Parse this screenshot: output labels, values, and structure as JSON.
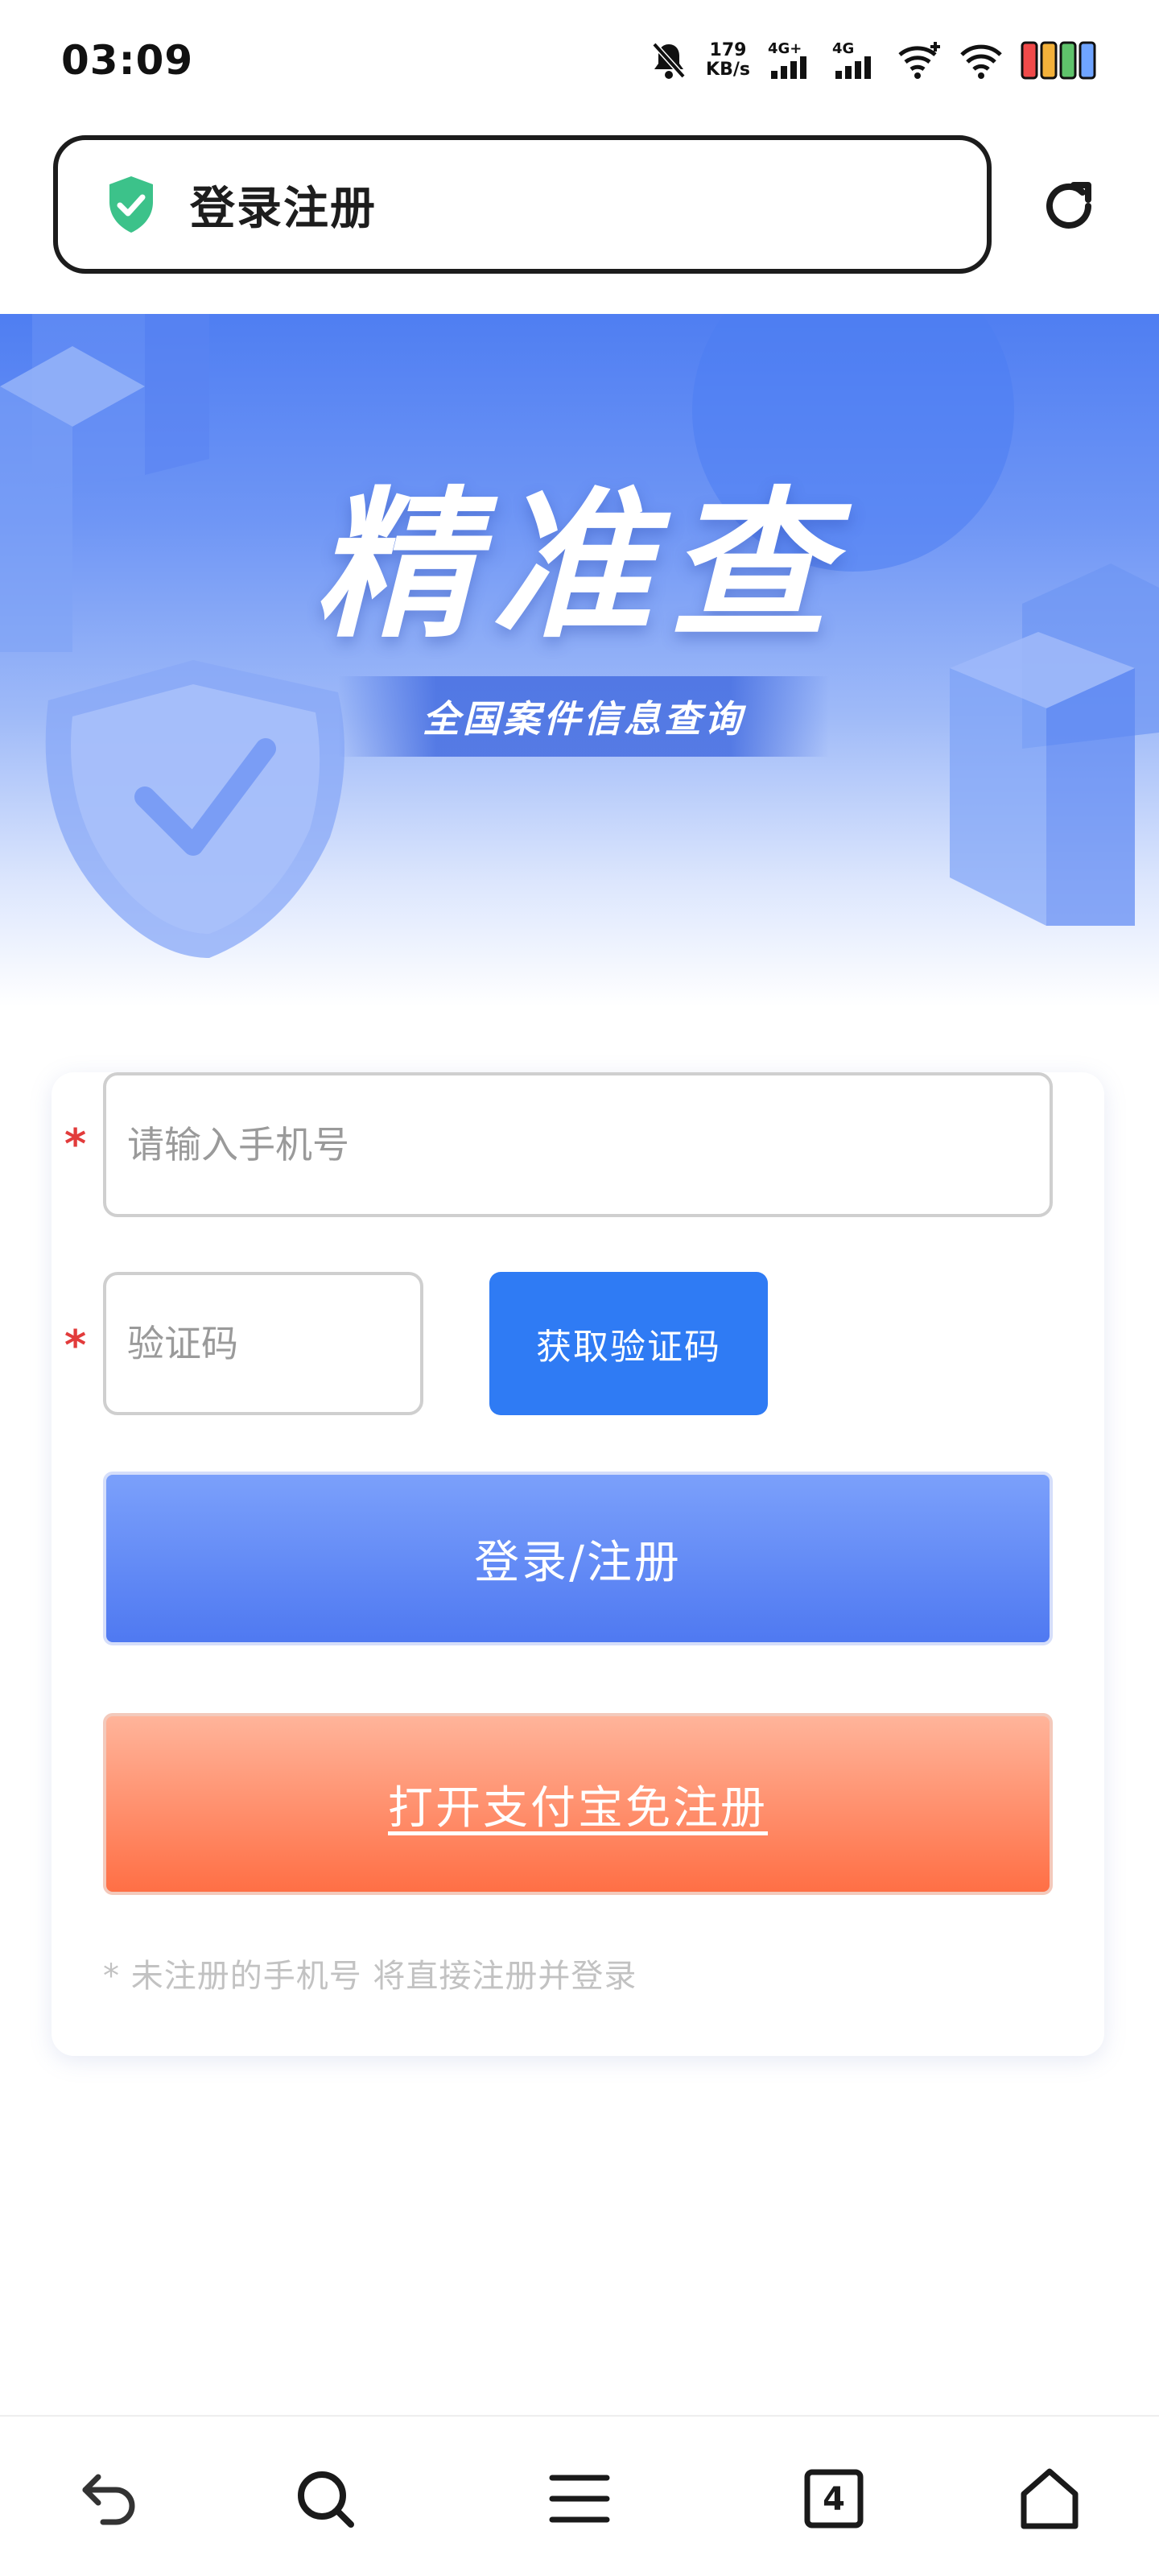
{
  "status_bar": {
    "time": "03:09",
    "net_speed_value": "179",
    "net_speed_unit": "KB/s",
    "sim1_label": "4G+",
    "sim2_label": "4G"
  },
  "address_bar": {
    "title": "登录注册",
    "secure_icon": "shield-check-icon",
    "reload_icon": "reload-icon"
  },
  "banner": {
    "title": "精准查",
    "subtitle": "全国案件信息查询"
  },
  "form": {
    "phone_placeholder": "请输入手机号",
    "phone_value": "",
    "code_placeholder": "验证码",
    "code_value": "",
    "required_mark": "*",
    "get_code_label": "获取验证码",
    "login_label": "登录/注册",
    "alipay_label": "打开支付宝免注册",
    "note": "* 未注册的手机号 将直接注册并登录"
  },
  "bottom_nav": {
    "tab_count": "4",
    "icons": [
      "back-icon",
      "search-icon",
      "menu-icon",
      "tabs-icon",
      "home-icon"
    ]
  },
  "colors": {
    "accent_blue": "#2f7bf4",
    "login_blue": "#5a82f2",
    "alipay_orange": "#ff7a50",
    "required_red": "#e23b3b",
    "secure_green": "#3cc28a"
  }
}
